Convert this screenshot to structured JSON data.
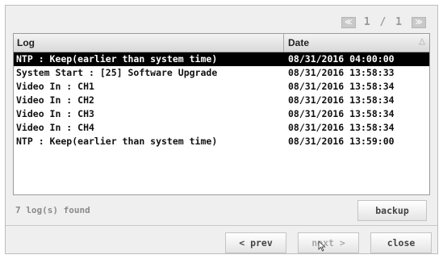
{
  "pager": {
    "prev_icon": "double-chevron-left-icon",
    "next_icon": "double-chevron-right-icon",
    "text": "1 / 1"
  },
  "table": {
    "headers": {
      "log": "Log",
      "date": "Date"
    },
    "sort_icon": "sort-triangle-icon",
    "rows": [
      {
        "log": "NTP : Keep(earlier than system time)",
        "date": "08/31/2016 04:00:00",
        "selected": true
      },
      {
        "log": "System Start : [25] Software Upgrade",
        "date": "08/31/2016 13:58:33",
        "selected": false
      },
      {
        "log": "Video In : CH1",
        "date": "08/31/2016 13:58:34",
        "selected": false
      },
      {
        "log": "Video In : CH2",
        "date": "08/31/2016 13:58:34",
        "selected": false
      },
      {
        "log": "Video In : CH3",
        "date": "08/31/2016 13:58:34",
        "selected": false
      },
      {
        "log": "Video In : CH4",
        "date": "08/31/2016 13:58:34",
        "selected": false
      },
      {
        "log": "NTP : Keep(earlier than system time)",
        "date": "08/31/2016 13:59:00",
        "selected": false
      }
    ]
  },
  "status": {
    "found_text": "7 log(s) found"
  },
  "buttons": {
    "backup": "backup",
    "prev": "< prev",
    "next": "next >",
    "close": "close"
  },
  "colors": {
    "selected_row_bg": "#000000",
    "disabled_text": "#a9a9a9"
  }
}
